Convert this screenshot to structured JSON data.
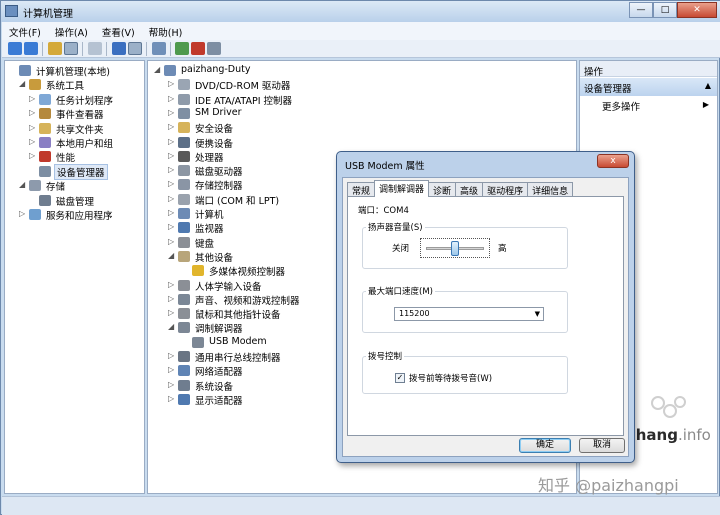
{
  "window": {
    "title": "计算机管理"
  },
  "menubar": [
    "文件(F)",
    "操作(A)",
    "查看(V)",
    "帮助(H)"
  ],
  "left_tree": [
    {
      "label": "计算机管理(本地)",
      "icon": "computer-icon",
      "color": "#6d8bb5",
      "exp": ""
    },
    {
      "label": "系统工具",
      "icon": "tools-icon",
      "color": "#c89b3c",
      "exp": "◢"
    },
    {
      "label": "任务计划程序",
      "icon": "clock-icon",
      "color": "#7fa8d6",
      "exp": "▷"
    },
    {
      "label": "事件查看器",
      "icon": "event-viewer-icon",
      "color": "#b5893d",
      "exp": "▷"
    },
    {
      "label": "共享文件夹",
      "icon": "shared-folder-icon",
      "color": "#d6b35a",
      "exp": "▷"
    },
    {
      "label": "本地用户和组",
      "icon": "users-icon",
      "color": "#8a7fc4",
      "exp": "▷"
    },
    {
      "label": "性能",
      "icon": "performance-icon",
      "color": "#c0392b",
      "exp": "▷"
    },
    {
      "label": "设备管理器",
      "icon": "device-manager-icon",
      "color": "#7d8ea3",
      "exp": ""
    },
    {
      "label": "存储",
      "icon": "storage-icon",
      "color": "#8d9aac",
      "exp": "◢"
    },
    {
      "label": "磁盘管理",
      "icon": "disk-icon",
      "color": "#6f7d8f",
      "exp": ""
    },
    {
      "label": "服务和应用程序",
      "icon": "services-icon",
      "color": "#6f9fcf",
      "exp": "▷"
    }
  ],
  "device_tree": [
    {
      "label": "paizhang-Duty",
      "icon": "computer-icon",
      "color": "#6d8bb5",
      "exp": "◢"
    },
    {
      "label": "DVD/CD-ROM 驱动器",
      "icon": "dvd-icon",
      "color": "#9aa5b3",
      "exp": "▷"
    },
    {
      "label": "IDE ATA/ATAPI 控制器",
      "icon": "ide-icon",
      "color": "#8f9baa",
      "exp": "▷"
    },
    {
      "label": "SM Driver",
      "icon": "driver-icon",
      "color": "#7f8fa3",
      "exp": "▷"
    },
    {
      "label": "安全设备",
      "icon": "security-device-icon",
      "color": "#d6b35a",
      "exp": "▷"
    },
    {
      "label": "便携设备",
      "icon": "portable-device-icon",
      "color": "#5c6f87",
      "exp": "▷"
    },
    {
      "label": "处理器",
      "icon": "processor-icon",
      "color": "#5a5a5a",
      "exp": "▷"
    },
    {
      "label": "磁盘驱动器",
      "icon": "disk-drive-icon",
      "color": "#8c96a3",
      "exp": "▷"
    },
    {
      "label": "存储控制器",
      "icon": "storage-controller-icon",
      "color": "#8a95a5",
      "exp": "▷"
    },
    {
      "label": "端口 (COM 和 LPT)",
      "icon": "port-icon",
      "color": "#9aa2ad",
      "exp": "▷"
    },
    {
      "label": "计算机",
      "icon": "computer-icon",
      "color": "#6d8bb5",
      "exp": "▷"
    },
    {
      "label": "监视器",
      "icon": "monitor-icon",
      "color": "#4f79b0",
      "exp": "▷"
    },
    {
      "label": "键盘",
      "icon": "keyboard-icon",
      "color": "#8b8f96",
      "exp": "▷"
    },
    {
      "label": "其他设备",
      "icon": "other-device-icon",
      "color": "#b8a57a",
      "exp": "◢"
    },
    {
      "label": "多媒体视频控制器",
      "icon": "warning-icon",
      "color": "#e1b52c",
      "exp": ""
    },
    {
      "label": "人体学输入设备",
      "icon": "hid-icon",
      "color": "#8b8f96",
      "exp": "▷"
    },
    {
      "label": "声音、视频和游戏控制器",
      "icon": "sound-icon",
      "color": "#7b8796",
      "exp": "▷"
    },
    {
      "label": "鼠标和其他指针设备",
      "icon": "mouse-icon",
      "color": "#8b8f96",
      "exp": "▷"
    },
    {
      "label": "调制解调器",
      "icon": "modem-icon",
      "color": "#7c8795",
      "exp": "◢"
    },
    {
      "label": "USB Modem",
      "icon": "modem-icon",
      "color": "#7c8795",
      "exp": ""
    },
    {
      "label": "通用串行总线控制器",
      "icon": "usb-icon",
      "color": "#6a7584",
      "exp": "▷"
    },
    {
      "label": "网络适配器",
      "icon": "network-icon",
      "color": "#5f84b5",
      "exp": "▷"
    },
    {
      "label": "系统设备",
      "icon": "system-device-icon",
      "color": "#6f7d8f",
      "exp": "▷"
    },
    {
      "label": "显示适配器",
      "icon": "display-adapter-icon",
      "color": "#4f79b0",
      "exp": "▷"
    }
  ],
  "actions_pane": {
    "title": "操作",
    "section": "设备管理器",
    "more": "更多操作"
  },
  "dialog": {
    "title": "USB Modem 属性",
    "close_label": "x",
    "tabs": [
      "常规",
      "调制解调器",
      "诊断",
      "高级",
      "驱动程序",
      "详细信息"
    ],
    "active_tab": "调制解调器",
    "port": "端口：COM4",
    "speaker": {
      "label": "扬声器音量(S)",
      "low": "关闭",
      "high": "高",
      "level_fraction": 0.5
    },
    "speed": {
      "label": "最大端口速度(M)",
      "value": "115200"
    },
    "dial": {
      "label": "拨号控制",
      "checkbox_label": "拨号前等待拨号音(W)",
      "checked": true
    },
    "ok": "确定",
    "cancel": "取消"
  },
  "watermarks": {
    "site_bold": "paizhang",
    "site_suffix": ".info",
    "zhihu": "知乎 @paizhangpi"
  }
}
